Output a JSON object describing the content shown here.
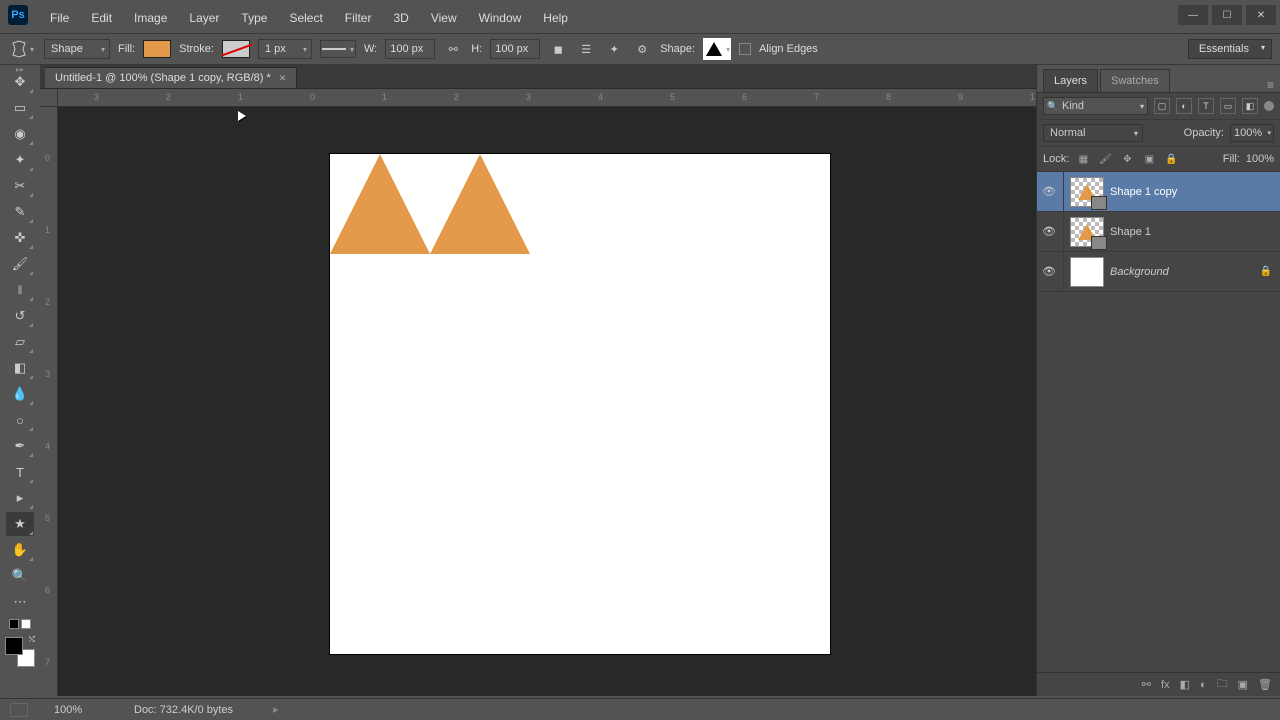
{
  "app": {
    "logo_text": "Ps"
  },
  "menu": [
    "File",
    "Edit",
    "Image",
    "Layer",
    "Type",
    "Select",
    "Filter",
    "3D",
    "View",
    "Window",
    "Help"
  ],
  "options": {
    "mode": "Shape",
    "fill_label": "Fill:",
    "fill_color": "#e29a4a",
    "stroke_label": "Stroke:",
    "stroke_width": "1 px",
    "w_label": "W:",
    "width_value": "100 px",
    "h_label": "H:",
    "height_value": "100 px",
    "shape_label": "Shape:",
    "align_edges_label": "Align Edges",
    "workspace": "Essentials"
  },
  "tab": {
    "title": "Untitled-1 @ 100% (Shape 1 copy, RGB/8) *"
  },
  "ruler_h": [
    "3",
    "2",
    "1",
    "0",
    "1",
    "2",
    "3",
    "4",
    "5",
    "6",
    "7",
    "8",
    "9",
    "1"
  ],
  "ruler_v": [
    "0",
    "1",
    "2",
    "3",
    "4",
    "5",
    "6",
    "7"
  ],
  "panels": {
    "layers_tab": "Layers",
    "swatches_tab": "Swatches",
    "kind_filter": "Kind",
    "blend_mode": "Normal",
    "opacity_label": "Opacity:",
    "opacity_value": "100%",
    "lock_label": "Lock:",
    "fill_label": "Fill:",
    "fill_value": "100%"
  },
  "layers": [
    {
      "name": "Shape 1 copy",
      "selected": true,
      "shape": true,
      "bg_locked": false
    },
    {
      "name": "Shape 1",
      "selected": false,
      "shape": true,
      "bg_locked": false
    },
    {
      "name": "Background",
      "selected": false,
      "shape": false,
      "bg_locked": true
    }
  ],
  "status": {
    "zoom": "100%",
    "doc_info": "Doc: 732.4K/0 bytes"
  }
}
